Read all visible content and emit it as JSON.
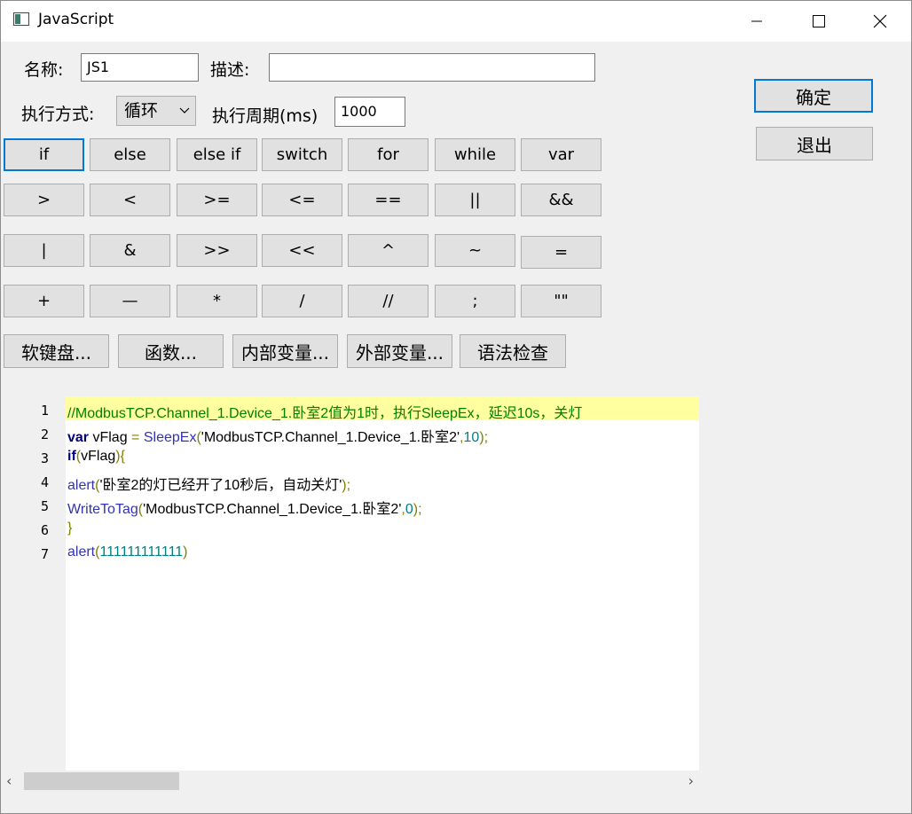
{
  "window": {
    "title": "JavaScript"
  },
  "form": {
    "name_label": "名称:",
    "name_value": "JS1",
    "desc_label": "描述:",
    "desc_value": "",
    "mode_label": "执行方式:",
    "mode_value": "循环",
    "period_label": "执行周期(ms)",
    "period_value": "1000"
  },
  "actions": {
    "ok": "确定",
    "exit": "退出"
  },
  "keys": {
    "row1": [
      "if",
      "else",
      "else if",
      "switch",
      "for",
      "while",
      "var"
    ],
    "row2": [
      ">",
      "<",
      ">=",
      "<=",
      "==",
      "||",
      "&&"
    ],
    "row3": [
      "|",
      "&",
      ">>",
      "<<",
      "^",
      "~",
      "="
    ],
    "row4": [
      "+",
      "—",
      "*",
      "/",
      "//",
      ";",
      "\"\""
    ]
  },
  "tools": [
    "软键盘...",
    "函数...",
    "内部变量...",
    "外部变量...",
    "语法检查"
  ],
  "editor": {
    "line_numbers": [
      "1",
      "2",
      "3",
      "4",
      "5",
      "6",
      "7"
    ],
    "lines": [
      [
        {
          "t": "//ModbusTCP.Channel_1.Device_1.卧室2值为1时，执行SleepEx，延迟10s，关灯",
          "c": "comment"
        }
      ],
      [
        {
          "t": "var",
          "c": "kw"
        },
        {
          "t": " vFlag ",
          "c": "id"
        },
        {
          "t": "=",
          "c": "punc"
        },
        {
          "t": " ",
          "c": "id"
        },
        {
          "t": "SleepEx",
          "c": "fn"
        },
        {
          "t": "(",
          "c": "punc"
        },
        {
          "t": "'ModbusTCP.Channel_1.Device_1.卧室2'",
          "c": "str"
        },
        {
          "t": ",",
          "c": "punc"
        },
        {
          "t": "10",
          "c": "num"
        },
        {
          "t": ");",
          "c": "punc"
        }
      ],
      [
        {
          "t": "if",
          "c": "kw"
        },
        {
          "t": "(",
          "c": "punc"
        },
        {
          "t": "vFlag",
          "c": "id"
        },
        {
          "t": "){",
          "c": "punc"
        }
      ],
      [
        {
          "t": "alert",
          "c": "fn"
        },
        {
          "t": "(",
          "c": "punc"
        },
        {
          "t": "'卧室2的灯已经开了10秒后，自动关灯'",
          "c": "str"
        },
        {
          "t": ");",
          "c": "punc"
        }
      ],
      [
        {
          "t": "WriteToTag",
          "c": "fn"
        },
        {
          "t": "(",
          "c": "punc"
        },
        {
          "t": "'ModbusTCP.Channel_1.Device_1.卧室2'",
          "c": "str"
        },
        {
          "t": ",",
          "c": "punc"
        },
        {
          "t": "0",
          "c": "num"
        },
        {
          "t": ");",
          "c": "punc"
        }
      ],
      [
        {
          "t": "}",
          "c": "punc"
        }
      ],
      [
        {
          "t": "alert",
          "c": "fn"
        },
        {
          "t": "(",
          "c": "punc"
        },
        {
          "t": "111111111111",
          "c": "num"
        },
        {
          "t": ")",
          "c": "punc"
        }
      ]
    ]
  },
  "scrollbar": {
    "left": "‹",
    "right": "›"
  }
}
